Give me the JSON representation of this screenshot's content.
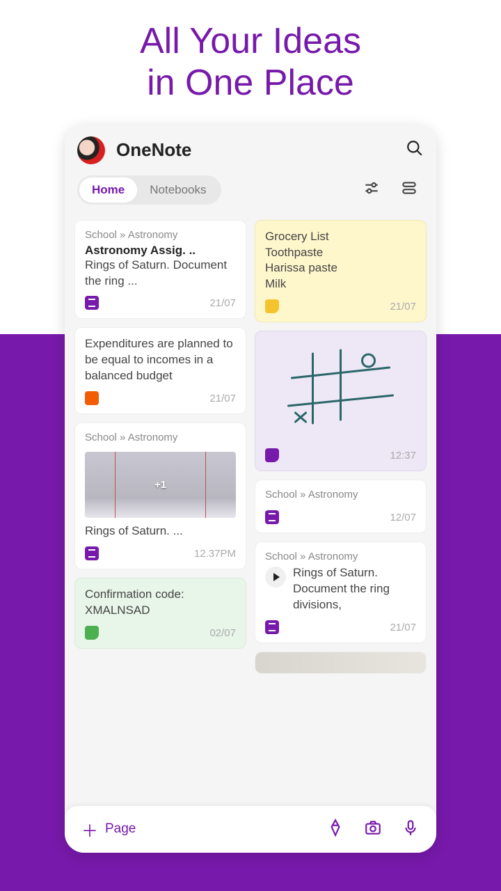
{
  "hero": {
    "line1": "All Your Ideas",
    "line2": "in One Place"
  },
  "app": {
    "title": "OneNote"
  },
  "tabs": {
    "home": "Home",
    "notebooks": "Notebooks"
  },
  "cards": {
    "left": [
      {
        "breadcrumb": "School » Astronomy",
        "title": "Astronomy Assig. ..",
        "body": "Rings of Saturn. Document the ring ...",
        "date": "21/07"
      },
      {
        "body": "Expenditures are planned to be equal to incomes in a balanced budget",
        "date": "21/07"
      },
      {
        "breadcrumb": "School » Astronomy",
        "thumbBadge": "+1",
        "body": "Rings of Saturn. ...",
        "date": "12.37PM"
      },
      {
        "body": "Confirmation code: XMALNSAD",
        "date": "02/07"
      }
    ],
    "right": [
      {
        "body": "Grocery List\nToothpaste\nHarissa paste\nMilk",
        "date": "21/07"
      },
      {
        "date": "12:37"
      },
      {
        "breadcrumb": "School » Astronomy",
        "date": "12/07"
      },
      {
        "breadcrumb": "School » Astronomy",
        "body": "Rings of Saturn. Document the ring divisions,",
        "date": "21/07"
      }
    ]
  },
  "bottombar": {
    "page": "Page"
  }
}
